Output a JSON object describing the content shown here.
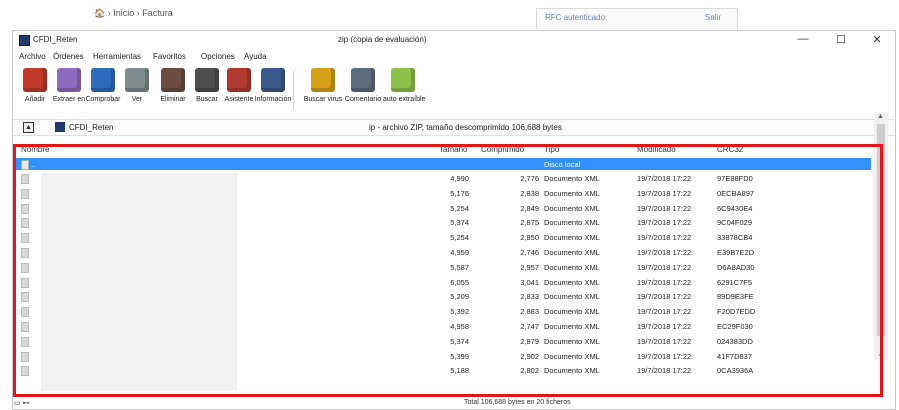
{
  "breadcrumb": {
    "home": "🏠",
    "sep": "›",
    "items": [
      "Inicio",
      "Factura"
    ]
  },
  "top_right": {
    "rfc_label": "RFC autenticado:",
    "link": "Salir"
  },
  "window": {
    "title": "CFDI_Reten",
    "subtitle": "zip (copia de evaluación)",
    "controls": {
      "minimize": "—",
      "maximize": "☐",
      "close": "✕"
    }
  },
  "menu": [
    "Archivo",
    "Órdenes",
    "Herramientas",
    "Favoritos",
    "Opciones",
    "Ayuda"
  ],
  "toolbar": [
    {
      "label": "Añadir",
      "icon": "add-icon",
      "color": "#c0392b"
    },
    {
      "label": "Extraer en",
      "icon": "extract-icon",
      "color": "#8e6bbf"
    },
    {
      "label": "Comprobar",
      "icon": "test-icon",
      "color": "#2c6cbf"
    },
    {
      "label": "Ver",
      "icon": "view-icon",
      "color": "#7f8c8d"
    },
    {
      "label": "Eliminar",
      "icon": "delete-icon",
      "color": "#6d4c41"
    },
    {
      "label": "Buscar",
      "icon": "find-icon",
      "color": "#4e4e4e"
    },
    {
      "label": "Asistente",
      "icon": "wizard-icon",
      "color": "#b03a2e"
    },
    {
      "label": "Información",
      "icon": "info-icon",
      "color": "#3a5a8c"
    },
    {
      "label": "Buscar virus",
      "icon": "virus-scan-icon",
      "color": "#d4a017"
    },
    {
      "label": "Comentario",
      "icon": "comment-icon",
      "color": "#5d6d7e"
    },
    {
      "label": "auto extraíble",
      "icon": "sfx-icon",
      "color": "#8bc34a"
    }
  ],
  "address": {
    "up_icon": "▲",
    "name": "CFDI_Reten",
    "description": "ip - archivo ZIP, tamaño descomprimido 106,688 bytes",
    "dropdown": "⌄"
  },
  "columns": [
    "Nombre",
    "Tamaño",
    "Comprimido",
    "Tipo",
    "Modificado",
    "CRC32"
  ],
  "selected_row": {
    "name": "..",
    "type": "Disco local"
  },
  "rows": [
    {
      "size": "4,990",
      "comp": "2,776",
      "type": "Documento XML",
      "mod": "19/7/2018 17:22",
      "crc": "97E88FD0"
    },
    {
      "size": "5,176",
      "comp": "2,838",
      "type": "Documento XML",
      "mod": "19/7/2018 17:22",
      "crc": "0ECBA897"
    },
    {
      "size": "5,254",
      "comp": "2,849",
      "type": "Documento XML",
      "mod": "19/7/2018 17:22",
      "crc": "6C9430E4"
    },
    {
      "size": "5,374",
      "comp": "2,875",
      "type": "Documento XML",
      "mod": "19/7/2018 17:22",
      "crc": "9C04F029"
    },
    {
      "size": "5,254",
      "comp": "2,850",
      "type": "Documento XML",
      "mod": "19/7/2018 17:22",
      "crc": "33878CB4"
    },
    {
      "size": "4,959",
      "comp": "2,746",
      "type": "Documento XML",
      "mod": "19/7/2018 17:22",
      "crc": "E39B7E2D"
    },
    {
      "size": "5,587",
      "comp": "2,957",
      "type": "Documento XML",
      "mod": "19/7/2018 17:22",
      "crc": "D6A8AD30"
    },
    {
      "size": "6,055",
      "comp": "3,041",
      "type": "Documento XML",
      "mod": "19/7/2018 17:22",
      "crc": "6291C7F5"
    },
    {
      "size": "5,209",
      "comp": "2,833",
      "type": "Documento XML",
      "mod": "19/7/2018 17:22",
      "crc": "89D9E3FE"
    },
    {
      "size": "5,392",
      "comp": "2,883",
      "type": "Documento XML",
      "mod": "19/7/2018 17:22",
      "crc": "F20D7EDD"
    },
    {
      "size": "4,958",
      "comp": "2,747",
      "type": "Documento XML",
      "mod": "19/7/2018 17:22",
      "crc": "EC29F030"
    },
    {
      "size": "5,374",
      "comp": "2,879",
      "type": "Documento XML",
      "mod": "19/7/2018 17:22",
      "crc": "024383DD"
    },
    {
      "size": "5,399",
      "comp": "2,902",
      "type": "Documento XML",
      "mod": "19/7/2018 17:22",
      "crc": "41F7D837"
    },
    {
      "size": "5,188",
      "comp": "2,802",
      "type": "Documento XML",
      "mod": "19/7/2018 17:22",
      "crc": "0CA3936A"
    }
  ],
  "scroll": {
    "up": "▲",
    "down": "⌄"
  },
  "status": {
    "icons": "▭ ⊷",
    "text": "Total 106,688 bytes en 20 ficheros"
  },
  "colors": {
    "highlight": "#e3151b",
    "selection": "#3390ff"
  }
}
